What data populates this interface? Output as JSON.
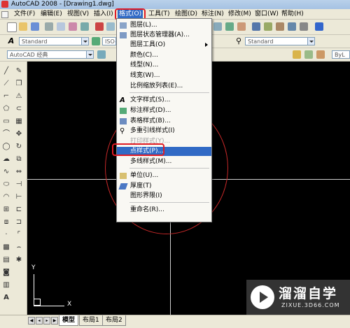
{
  "window": {
    "title": "AutoCAD 2008 - [Drawing1.dwg]"
  },
  "menubar": {
    "items": [
      "文件(F)",
      "编辑(E)",
      "视图(V)",
      "插入(I)",
      "格式(O)",
      "工具(T)",
      "绘图(D)",
      "标注(N)",
      "修改(M)",
      "窗口(W)",
      "帮助(H)"
    ],
    "active_index": 4
  },
  "toolbar": {
    "text_style": "Standard",
    "dim_style_partial": "ISO-2",
    "table_style": "Standard",
    "workspace": "AutoCAD 经典",
    "layer_partial": "ByL"
  },
  "format_menu": {
    "items": [
      {
        "label": "图层(L)...",
        "icon": "layers-icon"
      },
      {
        "label": "图层状态管理器(A)...",
        "icon": "layer-states-icon"
      },
      {
        "label": "图层工具(O)",
        "submenu": true
      },
      {
        "label": "颜色(C)..."
      },
      {
        "label": "线型(N)..."
      },
      {
        "label": "线宽(W)..."
      },
      {
        "label": "比例缩放列表(E)..."
      },
      {
        "label": "文字样式(S)...",
        "icon": "text-style-icon"
      },
      {
        "label": "标注样式(D)...",
        "icon": "dim-style-icon"
      },
      {
        "label": "表格样式(B)...",
        "icon": "table-style-icon"
      },
      {
        "label": "多重引线样式(I)",
        "icon": "mleader-style-icon"
      },
      {
        "label": "打印样式(Y)...",
        "disabled": true
      },
      {
        "label": "点样式(P)...",
        "highlighted": true
      },
      {
        "label": "多线样式(M)..."
      },
      {
        "label": "单位(U)...",
        "icon": "units-icon"
      },
      {
        "label": "厚度(T)",
        "icon": "thickness-icon"
      },
      {
        "label": "图形界限(I)"
      },
      {
        "label": "重命名(R)..."
      }
    ]
  },
  "canvas": {
    "axis_x": "X",
    "axis_y": "Y"
  },
  "layout_tabs": [
    "模型",
    "布局1",
    "布局2"
  ],
  "watermark": {
    "brand": "溜溜自学",
    "url": "ZIXUE.3D66.COM"
  },
  "colors": {
    "highlight": "#316ac5",
    "annotation_red": "#e01b24",
    "canvas": "#000000",
    "chrome": "#ece9d8"
  }
}
